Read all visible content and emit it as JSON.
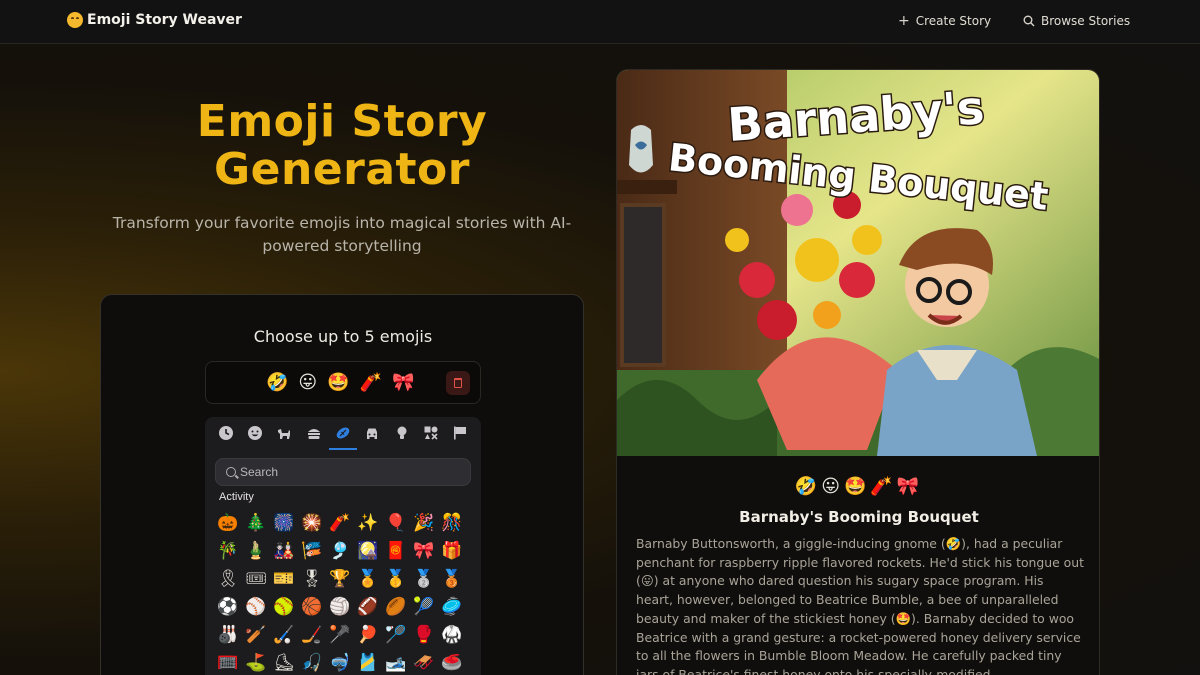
{
  "nav": {
    "brand": "Emoji Story Weaver",
    "create_label": "Create Story",
    "browse_label": "Browse Stories"
  },
  "hero": {
    "title": "Emoji Story Generator",
    "subtitle": "Transform your favorite emojis into magical stories with AI-powered storytelling"
  },
  "picker": {
    "heading": "Choose up to 5 emojis",
    "selected": [
      "🤣",
      "😛",
      "🤩",
      "🧨",
      "🎀"
    ],
    "categories": [
      "recent-icon",
      "smileys-icon",
      "animals-icon",
      "food-icon",
      "activity-icon",
      "travel-icon",
      "objects-icon",
      "symbols-icon",
      "flags-icon"
    ],
    "active_category": "Activity",
    "search_placeholder": "Search",
    "section_label": "Activity",
    "emojis": [
      "🎃",
      "🎄",
      "🎆",
      "🎇",
      "🧨",
      "✨",
      "🎈",
      "🎉",
      "🎊",
      "🎋",
      "🎍",
      "🎎",
      "🎏",
      "🎐",
      "🎑",
      "🧧",
      "🎀",
      "🎁",
      "🎗",
      "🎟",
      "🎫",
      "🎖",
      "🏆",
      "🏅",
      "🥇",
      "🥈",
      "🥉",
      "⚽",
      "⚾",
      "🥎",
      "🏀",
      "🏐",
      "🏈",
      "🏉",
      "🎾",
      "🥏",
      "🎳",
      "🏏",
      "🏑",
      "🏒",
      "🥍",
      "🏓",
      "🏸",
      "🥊",
      "🥋",
      "🥅",
      "⛳",
      "⛸",
      "🎣",
      "🤿",
      "🎽",
      "🎿",
      "🛷",
      "🥌"
    ]
  },
  "story": {
    "image_title_line1": "Barnaby's",
    "image_title_line2": "Booming Bouquet",
    "emojis": "🤣😛🤩🧨🎀",
    "title": "Barnaby's Booming Bouquet",
    "body": "Barnaby Buttonsworth, a giggle-inducing gnome (🤣), had a peculiar penchant for raspberry ripple flavored rockets. He'd stick his tongue out (😛) at anyone who dared question his sugary space program. His heart, however, belonged to Beatrice Bumble, a bee of unparalleled beauty and maker of the stickiest honey (🤩). Barnaby decided to woo Beatrice with a grand gesture: a rocket-powered honey delivery service to all the flowers in Bumble Bloom Meadow. He carefully packed tiny jars of Beatrice's finest honey onto his specially-modified"
  },
  "colors": {
    "accent": "#efb514",
    "background": "#121110",
    "card": "#0e0d0c",
    "active_tab": "#2f7fe0",
    "danger": "#e05247"
  }
}
